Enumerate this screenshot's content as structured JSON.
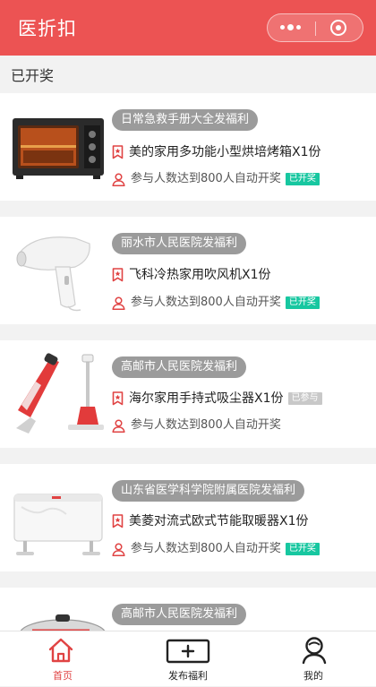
{
  "header": {
    "title": "医折扣"
  },
  "section": {
    "title": "已开奖"
  },
  "cards": [
    {
      "hospital": "日常急救手册大全发福利",
      "prize": "美的家用多功能小型烘培烤箱X1份",
      "rule": "参与人数达到800人自动开奖",
      "status": "已开奖",
      "status_type": "done",
      "image": "oven-image"
    },
    {
      "hospital": "丽水市人民医院发福利",
      "prize": "飞科冷热家用吹风机X1份",
      "rule": "参与人数达到800人自动开奖",
      "status": "已开奖",
      "status_type": "done",
      "image": "hair-dryer-image"
    },
    {
      "hospital": "高邮市人民医院发福利",
      "prize": "海尔家用手持式吸尘器X1份",
      "rule": "参与人数达到800人自动开奖",
      "status": "已参与",
      "status_type": "joined",
      "image": "vacuum-image"
    },
    {
      "hospital": "山东省医学科学院附属医院发福利",
      "prize": "美菱对流式欧式节能取暖器X1份",
      "rule": "参与人数达到800人自动开奖",
      "status": "已开奖",
      "status_type": "done",
      "image": "heater-image"
    },
    {
      "hospital": "高邮市人民医院发福利",
      "prize": "",
      "rule": "",
      "status": "",
      "status_type": "",
      "image": "pot-image"
    }
  ],
  "tabbar": {
    "home": "首页",
    "publish": "发布福利",
    "mine": "我的"
  },
  "colors": {
    "brand": "#ec5353",
    "drawn_badge": "#17c7a0",
    "joined_badge": "#c8c8c8",
    "icon_red": "#e04343"
  }
}
